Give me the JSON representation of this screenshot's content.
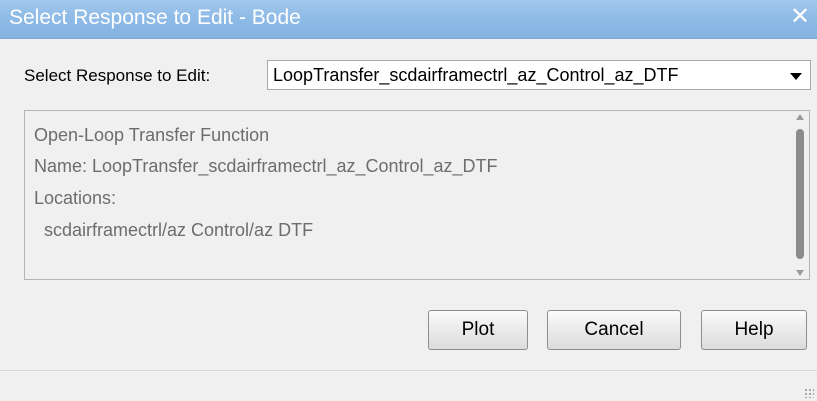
{
  "window": {
    "title": "Select Response to Edit - Bode",
    "close_glyph": "✕"
  },
  "selector": {
    "label": "Select Response to Edit:",
    "selected_value": "LoopTransfer_scdairframectrl_az_Control_az_DTF"
  },
  "info": {
    "lines": [
      "Open-Loop Transfer Function",
      "Name: LoopTransfer_scdairframectrl_az_Control_az_DTF",
      "Locations:",
      "  scdairframectrl/az Control/az DTF"
    ]
  },
  "buttons": {
    "plot": "Plot",
    "cancel": "Cancel",
    "help": "Help"
  },
  "colors": {
    "titlebar": "#8fbbe7",
    "info_text": "#6d6d6d"
  }
}
